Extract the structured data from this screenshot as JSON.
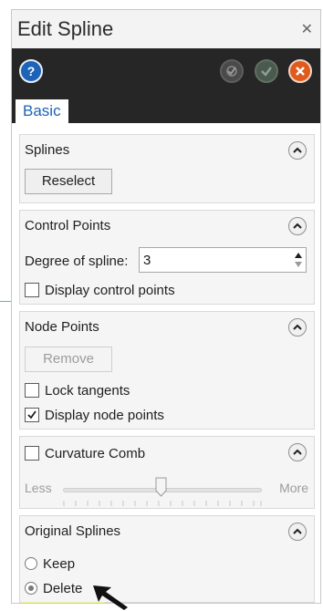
{
  "dialog": {
    "title": "Edit Spline",
    "close_icon": "close-icon",
    "toolbar": {
      "help_icon": "help-icon",
      "apply_icon": "apply-icon",
      "ok_icon": "ok-check-icon",
      "cancel_icon": "cancel-icon"
    },
    "tabs": [
      {
        "label": "Basic",
        "active": true
      }
    ],
    "accent_color": "#1d63b8",
    "sections": {
      "splines": {
        "title": "Splines",
        "reselect_label": "Reselect"
      },
      "control_points": {
        "title": "Control Points",
        "degree_label": "Degree of spline:",
        "degree_value": "3",
        "display_control_points_label": "Display control points",
        "display_control_points_checked": false
      },
      "node_points": {
        "title": "Node Points",
        "remove_label": "Remove",
        "remove_enabled": false,
        "lock_tangents_label": "Lock tangents",
        "lock_tangents_checked": false,
        "display_node_points_label": "Display node points",
        "display_node_points_checked": true
      },
      "curvature_comb": {
        "title": "Curvature Comb",
        "checked": false,
        "less_label": "Less",
        "more_label": "More",
        "slider_level": 0.5
      },
      "original_splines": {
        "title": "Original Splines",
        "options": [
          {
            "label": "Keep",
            "selected": false
          },
          {
            "label": "Delete",
            "selected": true
          }
        ],
        "highlight_color": "#f5f796"
      }
    }
  }
}
